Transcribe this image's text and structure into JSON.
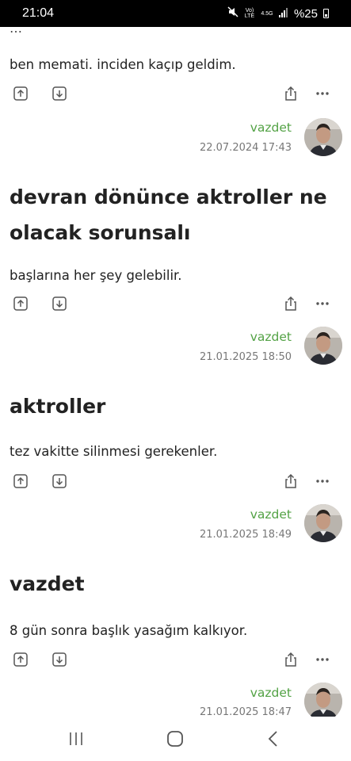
{
  "status_bar": {
    "time": "21:04",
    "volte_label": "Vo) LTE",
    "network_label": "4.5G",
    "battery_text": "%25"
  },
  "top_fragment": "…",
  "entries": [
    {
      "title": "",
      "text": "ben memati. inciden kaçıp geldim.",
      "author": "vazdet",
      "date": "22.07.2024 17:43"
    },
    {
      "title": "devran dönünce aktroller ne olacak sorunsalı",
      "text": "başlarına her şey gelebilir.",
      "author": "vazdet",
      "date": "21.01.2025 18:50"
    },
    {
      "title": "aktroller",
      "text": "tez vakitte silinmesi gerekenler.",
      "author": "vazdet",
      "date": "21.01.2025 18:49"
    },
    {
      "title": "vazdet",
      "text": "8 gün sonra başlık yasağım kalkıyor.",
      "author": "vazdet",
      "date": "21.01.2025 18:47"
    }
  ],
  "colors": {
    "author": "#53a245",
    "date": "#777777",
    "icon": "#555555"
  },
  "icons": {
    "upvote": "arrow-up-box-icon",
    "downvote": "arrow-down-box-icon",
    "share": "share-icon",
    "more": "more-dots-icon"
  },
  "nav": {
    "recents": "recents-icon",
    "home": "home-icon",
    "back": "back-icon"
  }
}
